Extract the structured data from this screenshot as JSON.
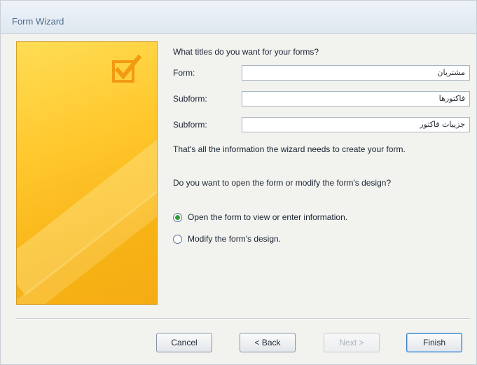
{
  "window": {
    "title": "Form Wizard"
  },
  "wizard": {
    "heading": "What titles do you want for your forms?",
    "fields": [
      {
        "label": "Form:",
        "value": "مشتریان"
      },
      {
        "label": "Subform:",
        "value": "فاکتورها"
      },
      {
        "label": "Subform:",
        "value": "جزییات فاکتور"
      }
    ],
    "info1": "That's all the information the wizard needs to create your form.",
    "info2": "Do you want to open the form or modify the form's design?",
    "options": [
      {
        "label": "Open the form to view or enter information.",
        "selected": true
      },
      {
        "label": "Modify the form's design.",
        "selected": false
      }
    ]
  },
  "buttons": {
    "cancel": "Cancel",
    "back": "< Back",
    "next": "Next >",
    "finish": "Finish"
  },
  "colors": {
    "panel_yellow": "#ffc72c",
    "selected_radio": "#2f9c3a",
    "title_blue": "#4c6b8f"
  }
}
